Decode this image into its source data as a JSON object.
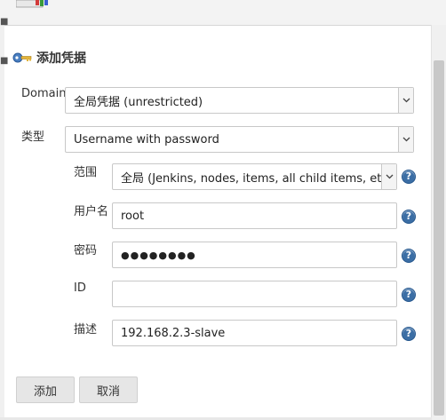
{
  "dialog": {
    "title": "添加凭据",
    "icons": {
      "title": "key-icon",
      "help": "question-mark-icon",
      "dropdown": "chevron-down-icon"
    },
    "colors": {
      "help_icon": "#3b6ea5",
      "button_bg": "#e6e6e6"
    }
  },
  "fields": {
    "domain": {
      "label": "Domain",
      "value": "全局凭据 (unrestricted)"
    },
    "kind": {
      "label": "类型",
      "value": "Username with password"
    },
    "scope": {
      "label": "范围",
      "value": "全局 (Jenkins, nodes, items, all child items, etc)",
      "help": "?"
    },
    "username": {
      "label": "用户名",
      "value": "root",
      "help": "?"
    },
    "password": {
      "label": "密码",
      "value": "●●●●●●●●",
      "help": "?"
    },
    "id": {
      "label": "ID",
      "value": "",
      "help": "?"
    },
    "description": {
      "label": "描述",
      "value": "192.168.2.3-slave",
      "help": "?"
    }
  },
  "buttons": {
    "add": "添加",
    "cancel": "取消"
  }
}
